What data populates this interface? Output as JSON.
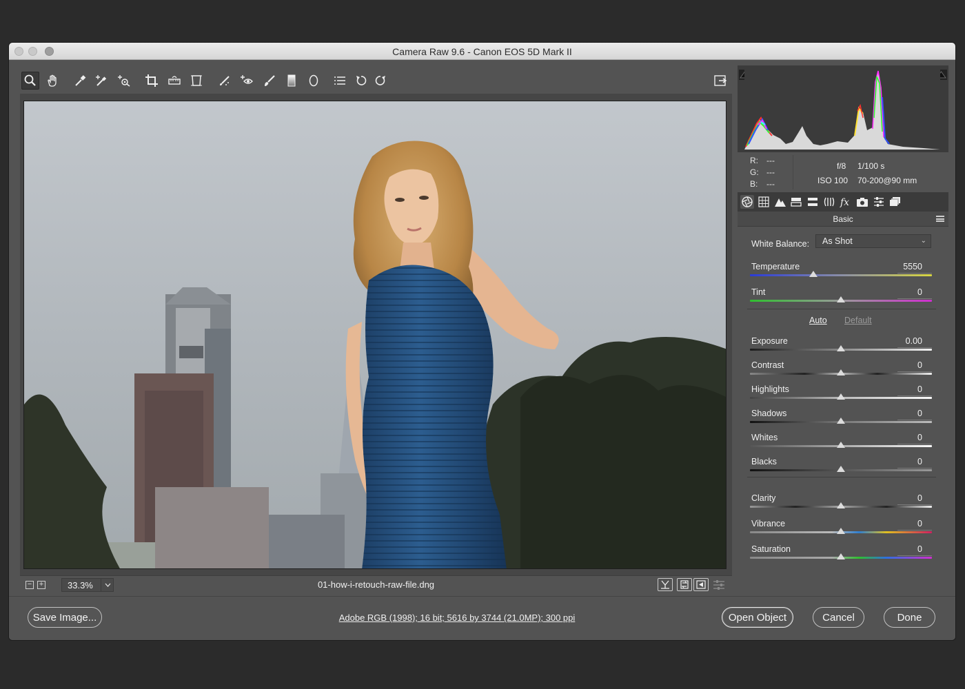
{
  "window": {
    "title": "Camera Raw 9.6  -  Canon EOS 5D Mark II"
  },
  "toolbar": {
    "tools": [
      {
        "name": "zoom-tool",
        "icon": "magnifier-icon",
        "active": true
      },
      {
        "name": "hand-tool",
        "icon": "hand-icon"
      },
      {
        "name": "white-balance-tool",
        "icon": "eyedropper-icon"
      },
      {
        "name": "color-sampler-tool",
        "icon": "eyedropper-plus-icon"
      },
      {
        "name": "targeted-adjustment-tool",
        "icon": "target-adjust-icon"
      },
      {
        "name": "crop-tool",
        "icon": "crop-icon"
      },
      {
        "name": "straighten-tool",
        "icon": "level-icon"
      },
      {
        "name": "transform-tool",
        "icon": "transform-icon"
      },
      {
        "name": "spot-removal-tool",
        "icon": "brush-heal-icon"
      },
      {
        "name": "red-eye-tool",
        "icon": "red-eye-icon"
      },
      {
        "name": "adjustment-brush-tool",
        "icon": "brush-icon"
      },
      {
        "name": "graduated-filter-tool",
        "icon": "gradient-icon"
      },
      {
        "name": "radial-filter-tool",
        "icon": "ellipse-icon"
      },
      {
        "name": "preferences-button",
        "icon": "list-icon"
      },
      {
        "name": "rotate-ccw-button",
        "icon": "rotate-left-icon"
      },
      {
        "name": "rotate-cw-button",
        "icon": "rotate-right-icon"
      }
    ],
    "fullscreen_icon": "fullscreen-icon"
  },
  "status": {
    "zoom": "33.3%",
    "filename": "01-how-i-retouch-raw-file.dng"
  },
  "info": {
    "r_label": "R:",
    "g_label": "G:",
    "b_label": "B:",
    "r_value": "---",
    "g_value": "---",
    "b_value": "---",
    "aperture": "f/8",
    "shutter": "1/100 s",
    "iso": "ISO 100",
    "lens": "70-200@90 mm"
  },
  "panel": {
    "title": "Basic",
    "white_balance_label": "White Balance:",
    "white_balance_value": "As Shot",
    "auto_label": "Auto",
    "default_label": "Default",
    "sliders": [
      {
        "key": "temperature",
        "label": "Temperature",
        "value": "5550",
        "level": 0.35
      },
      {
        "key": "tint",
        "label": "Tint",
        "value": "0",
        "level": 0.5
      },
      {
        "key": "exposure",
        "label": "Exposure",
        "value": "0.00",
        "level": 0.5
      },
      {
        "key": "contrast",
        "label": "Contrast",
        "value": "0",
        "level": 0.5
      },
      {
        "key": "highlights",
        "label": "Highlights",
        "value": "0",
        "level": 0.5
      },
      {
        "key": "shadows",
        "label": "Shadows",
        "value": "0",
        "level": 0.5
      },
      {
        "key": "whites",
        "label": "Whites",
        "value": "0",
        "level": 0.5
      },
      {
        "key": "blacks",
        "label": "Blacks",
        "value": "0",
        "level": 0.5
      },
      {
        "key": "clarity",
        "label": "Clarity",
        "value": "0",
        "level": 0.5
      },
      {
        "key": "vibrance",
        "label": "Vibrance",
        "value": "0",
        "level": 0.5
      },
      {
        "key": "saturation",
        "label": "Saturation",
        "value": "0",
        "level": 0.5
      }
    ]
  },
  "footer": {
    "save_label": "Save Image...",
    "workflow_label": "Adobe RGB (1998); 16 bit; 5616 by 3744 (21.0MP); 300 ppi",
    "open_label": "Open Object",
    "cancel_label": "Cancel",
    "done_label": "Done"
  }
}
